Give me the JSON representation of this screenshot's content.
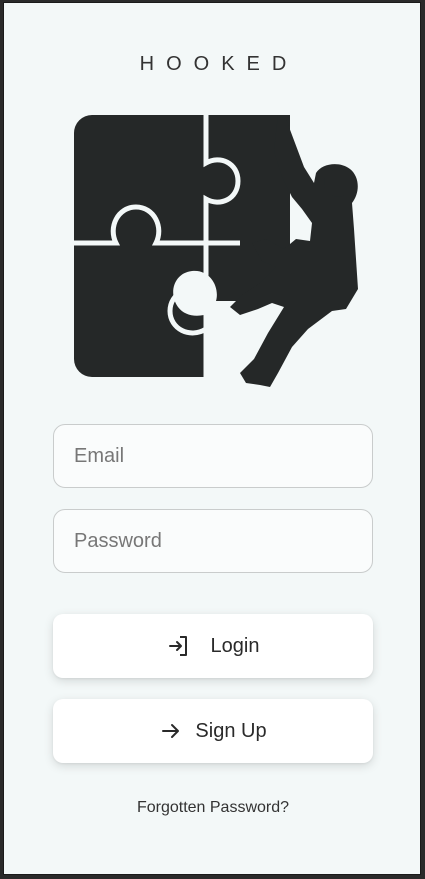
{
  "app": {
    "title": "HOOKED"
  },
  "login_form": {
    "email": {
      "placeholder": "Email",
      "value": ""
    },
    "password": {
      "placeholder": "Password",
      "value": ""
    },
    "login_label": "Login",
    "signup_label": "Sign Up",
    "forgot_label": "Forgotten Password?"
  },
  "icons": {
    "logo": "puzzle-climber-logo",
    "login": "login-arrow-icon",
    "signup": "arrow-right-icon"
  },
  "colors": {
    "background": "#f3f8f8",
    "logo": "#252828",
    "text": "#333333"
  }
}
